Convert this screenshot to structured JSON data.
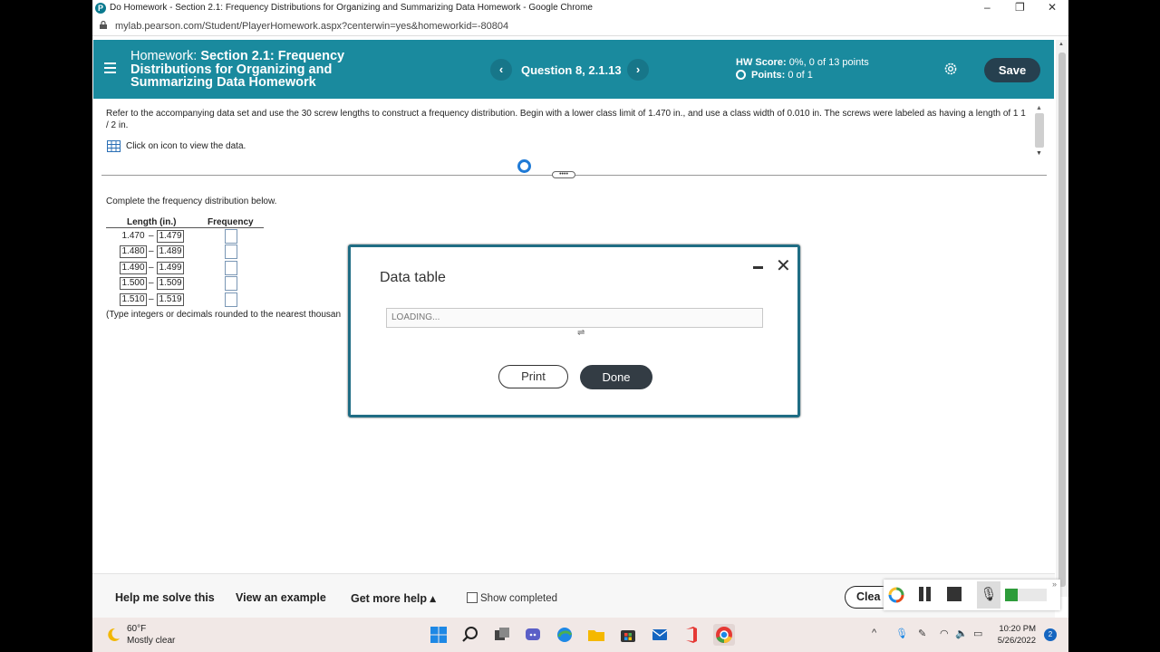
{
  "browser": {
    "window_title": "Do Homework - Section 2.1: Frequency Distributions for Organizing and Summarizing Data Homework - Google Chrome",
    "url": "mylab.pearson.com/Student/PlayerHomework.aspx?centerwin=yes&homeworkid=-80804",
    "minimize": "–",
    "restore": "❐",
    "close": "✕"
  },
  "header": {
    "homework_label": "Homework:",
    "homework_title": "Section 2.1: Frequency Distributions for Organizing and Summarizing Data Homework",
    "prev": "‹",
    "next": "›",
    "question_label": "Question 8, 2.1.13",
    "hw_score_label": "HW Score:",
    "hw_score_value": "0%, 0 of 13 points",
    "points_label": "Points:",
    "points_value": "0 of 1",
    "save_label": "Save",
    "colors": {
      "header_bg": "#1a8a9e",
      "save_bg": "#26404f"
    }
  },
  "question": {
    "text": "Refer to the accompanying data set and use the 30 screw lengths to construct a frequency distribution. Begin with a lower class limit of 1.470 in., and use a class width of 0.010 in. The screws were labeled as having a length of 1 1 / 2 in.",
    "data_link": "Click on icon to view the data.",
    "divider_handle": "••••"
  },
  "table": {
    "instruction": "Complete the frequency distribution below.",
    "col_length": "Length (in.)",
    "col_frequency": "Frequency",
    "rows": [
      {
        "lo": "1.470",
        "hi": "1.479",
        "freq": ""
      },
      {
        "lo": "1.480",
        "hi": "1.489",
        "freq": ""
      },
      {
        "lo": "1.490",
        "hi": "1.499",
        "freq": ""
      },
      {
        "lo": "1.500",
        "hi": "1.509",
        "freq": ""
      },
      {
        "lo": "1.510",
        "hi": "1.519",
        "freq": ""
      }
    ],
    "dash": "–",
    "note": "(Type integers or decimals rounded to the nearest thousan"
  },
  "modal": {
    "title": "Data table",
    "loading": "LOADING...",
    "print": "Print",
    "done": "Done"
  },
  "footer": {
    "help_solve": "Help me solve this",
    "view_example": "View an example",
    "more_help": "Get more help ▴",
    "show_completed": "Show completed",
    "clear": "Clea"
  },
  "taskbar": {
    "temperature": "60°F",
    "condition": "Mostly clear",
    "time": "10:20 PM",
    "date": "5/26/2022",
    "notifications": "2"
  }
}
